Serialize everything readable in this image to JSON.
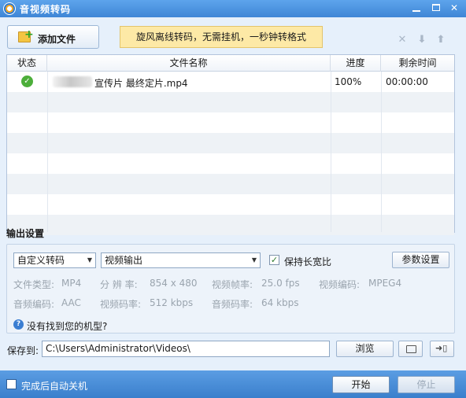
{
  "window": {
    "title": "音视频转码",
    "minimize_icon": "minimize-icon",
    "maximize_icon": "maximize-icon",
    "close_icon": "close-icon"
  },
  "toolbar": {
    "add_file_label": "添加文件",
    "banner_text": "旋风离线转码，无需挂机，一秒钟转格式",
    "remove_icon": "remove-icon",
    "move_down_icon": "arrow-down-icon",
    "move_up_icon": "arrow-up-icon"
  },
  "table": {
    "headers": {
      "status": "状态",
      "name": "文件名称",
      "progress": "进度",
      "remaining": "剩余时间"
    },
    "rows": [
      {
        "status_icon": "check-circle-icon",
        "name": "宣传片 最终定片.mp4",
        "progress": "100%",
        "remaining": "00:00:00"
      }
    ]
  },
  "output": {
    "section_title": "输出设置",
    "mode_select": "自定义转码",
    "format_select": "视频输出",
    "keep_ratio_label": "保持长宽比",
    "keep_ratio_checked": true,
    "params_button": "参数设置",
    "info": {
      "file_type_label": "文件类型:",
      "file_type_value": "MP4",
      "resolution_label": "分 辨 率:",
      "resolution_value": "854 x 480",
      "framerate_label": "视频帧率:",
      "framerate_value": "25.0 fps",
      "vcodec_label": "视频编码:",
      "vcodec_value": "MPEG4",
      "acodec_label": "音频编码:",
      "acodec_value": "AAC",
      "vbitrate_label": "视频码率:",
      "vbitrate_value": "512 kbps",
      "abitrate_label": "音频码率:",
      "abitrate_value": "64 kbps"
    },
    "help_link": "没有找到您的机型?"
  },
  "save": {
    "label": "保存到:",
    "path": "C:\\Users\\Administrator\\Videos\\",
    "browse_button": "浏览"
  },
  "footer": {
    "auto_shutdown_label": "完成后自动关机",
    "start_button": "开始",
    "stop_button": "停止"
  }
}
